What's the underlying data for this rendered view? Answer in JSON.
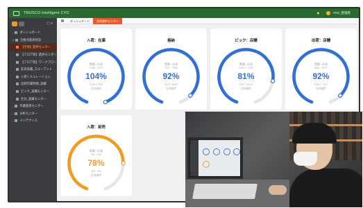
{
  "app": {
    "title": "TRUSCO Intelligent CYC",
    "user": "YRD_管理者"
  },
  "sidebar": {
    "items": [
      {
        "label": "ダッシュボード",
        "level": 0
      },
      {
        "label": "全拠点進捗状況",
        "level": 0,
        "expanded": true
      },
      {
        "label": "【全体】進捗モニター",
        "level": 1,
        "active": true
      },
      {
        "label": "【フロア別】進捗モニター",
        "level": 1
      },
      {
        "label": "【フロア別】ワークフロー",
        "level": 1
      },
      {
        "label": "前日実績_スループット",
        "level": 1
      },
      {
        "label": "入荷シミュレーション",
        "level": 1
      },
      {
        "label": "出荷作業時間_実績",
        "level": 1
      },
      {
        "label": "ピック_実績モニター",
        "level": 1
      },
      {
        "label": "仕分_実績モニター",
        "level": 1
      },
      {
        "label": "作業進捗モニター",
        "level": 0
      },
      {
        "label": "分析モニター",
        "level": 0
      },
      {
        "label": "メンテナンス",
        "level": 0
      }
    ]
  },
  "tabs": [
    {
      "label": "ダッシュボード"
    },
    {
      "label": "全体進捗モニター",
      "active": true
    }
  ],
  "gauges": [
    {
      "title": "入荷：在庫",
      "line1": "実績 / 計画",
      "line2": "1968 / 1875",
      "percent_text": "104%",
      "percent": 104,
      "line3": "2346 / 2250",
      "line4": "全体進捗",
      "color": "#2f6fd6"
    },
    {
      "title": "格納",
      "line1": "実績 / 計画",
      "line2": "7087 / 7696",
      "percent_text": "92%",
      "percent": 92,
      "line3": "7823 / 8455",
      "line4": "全体進捗",
      "color": "#2f6fd6"
    },
    {
      "title": "ピック：店舗",
      "line1": "実績 / 計画",
      "line2": "5844 / 7246",
      "percent_text": "81%",
      "percent": 81,
      "line3": "6597 / 8121",
      "line4": "全体進捗",
      "color": "#2f6fd6"
    },
    {
      "title": "出荷：店舗",
      "line1": "実績 / 計画",
      "line2": "5861 / 6370",
      "percent_text": "92%",
      "percent": 92,
      "line3": "6461 / 7117",
      "line4": "全体進捗",
      "color": "#2f6fd6"
    },
    {
      "title": "入荷：卸売",
      "line1": "実績 / 計画",
      "line2": "331 / 422",
      "percent_text": "78%",
      "percent": 78,
      "line3": "383 / 492",
      "line4": "全体進捗",
      "color": "#f39a1f"
    }
  ]
}
